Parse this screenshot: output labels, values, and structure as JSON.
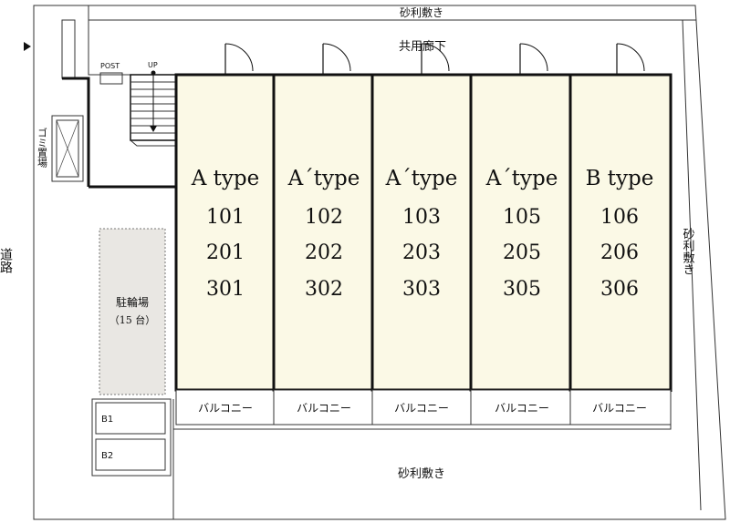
{
  "labels": {
    "gravel_top": "砂利敷き",
    "gravel_right": "砂利敷き",
    "gravel_bottom": "砂利敷き",
    "corridor": "共用廊下",
    "road": "道路",
    "post": "POST",
    "up": "UP",
    "garbage": "ゴミ置場",
    "bike_parking": "駐輪場",
    "bike_count": "（15 台）",
    "b1": "B1",
    "b2": "B2"
  },
  "units": [
    {
      "type": "A type",
      "rooms": [
        "101",
        "201",
        "301"
      ],
      "balcony": "バルコニー"
    },
    {
      "type": "A´type",
      "rooms": [
        "102",
        "202",
        "302"
      ],
      "balcony": "バルコニー"
    },
    {
      "type": "A´type",
      "rooms": [
        "103",
        "203",
        "303"
      ],
      "balcony": "バルコニー"
    },
    {
      "type": "A´type",
      "rooms": [
        "105",
        "205",
        "305"
      ],
      "balcony": "バルコニー"
    },
    {
      "type": "B type",
      "rooms": [
        "106",
        "206",
        "306"
      ],
      "balcony": "バルコニー"
    }
  ],
  "colors": {
    "unit_fill": "#fbf9e6",
    "bike_fill": "#e9e7e3",
    "line": "#111111"
  }
}
